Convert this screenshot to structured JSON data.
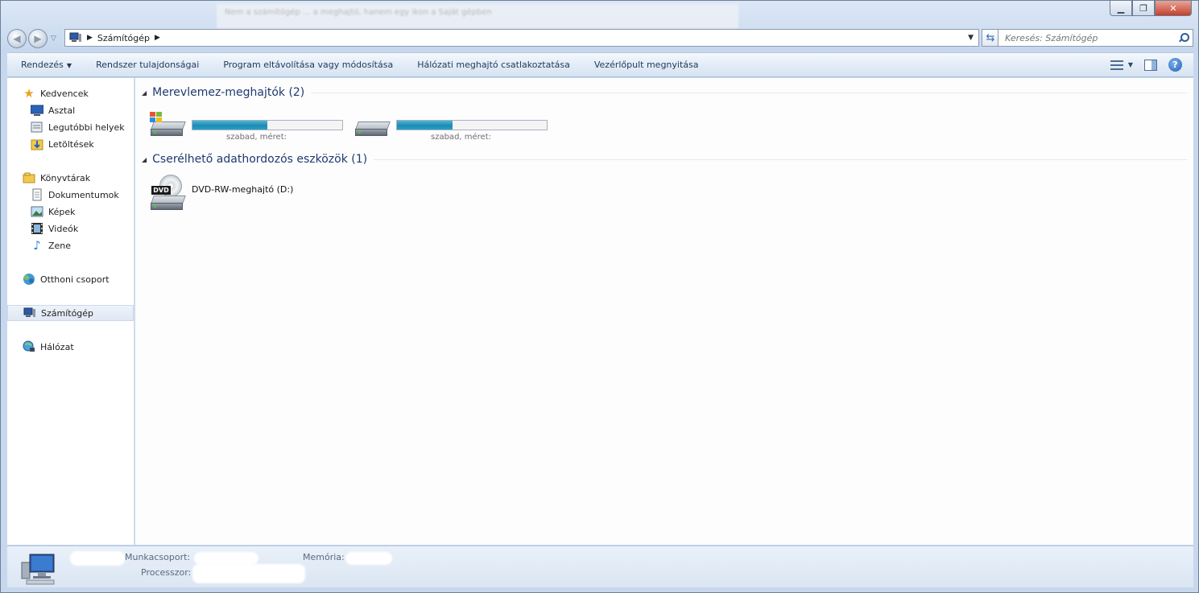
{
  "window": {
    "caption": {
      "minimize": "▁",
      "maximize": "❐",
      "close": "✕"
    },
    "blurred_title": "Nem a számítógép ... a meghajtó, hanem egy ikon a Saját gépben"
  },
  "address": {
    "crumb": "Számítógép",
    "search_placeholder": "Keresés: Számítógép"
  },
  "toolbar": {
    "organize": "Rendezés",
    "system_properties": "Rendszer tulajdonságai",
    "uninstall": "Program eltávolítása vagy módosítása",
    "map_drive": "Hálózati meghajtó csatlakoztatása",
    "control_panel": "Vezérlőpult megnyitása",
    "help": "?"
  },
  "sidebar": {
    "favorites": "Kedvencek",
    "desktop": "Asztal",
    "recent": "Legutóbbi helyek",
    "downloads": "Letöltések",
    "libraries": "Könyvtárak",
    "documents": "Dokumentumok",
    "pictures": "Képek",
    "videos": "Videók",
    "music": "Zene",
    "homegroup": "Otthoni csoport",
    "computer": "Számítógép",
    "network": "Hálózat"
  },
  "content": {
    "hdd_group": "Merevlemez-meghajtók (2)",
    "removable_group": "Cserélhető adathordozós eszközök (1)",
    "drives": [
      {
        "usage": 0.5,
        "caption": "szabad, méret:"
      },
      {
        "usage": 0.37,
        "caption": "szabad, méret:"
      }
    ],
    "dvd": "DVD-RW-meghajtó (D:)"
  },
  "details": {
    "workgroup": "Munkacsoport:",
    "memory": "Memória:",
    "processor": "Processzor:"
  },
  "colors": {
    "accent": "#1e3a6e",
    "bar": "#1f8ab5"
  }
}
